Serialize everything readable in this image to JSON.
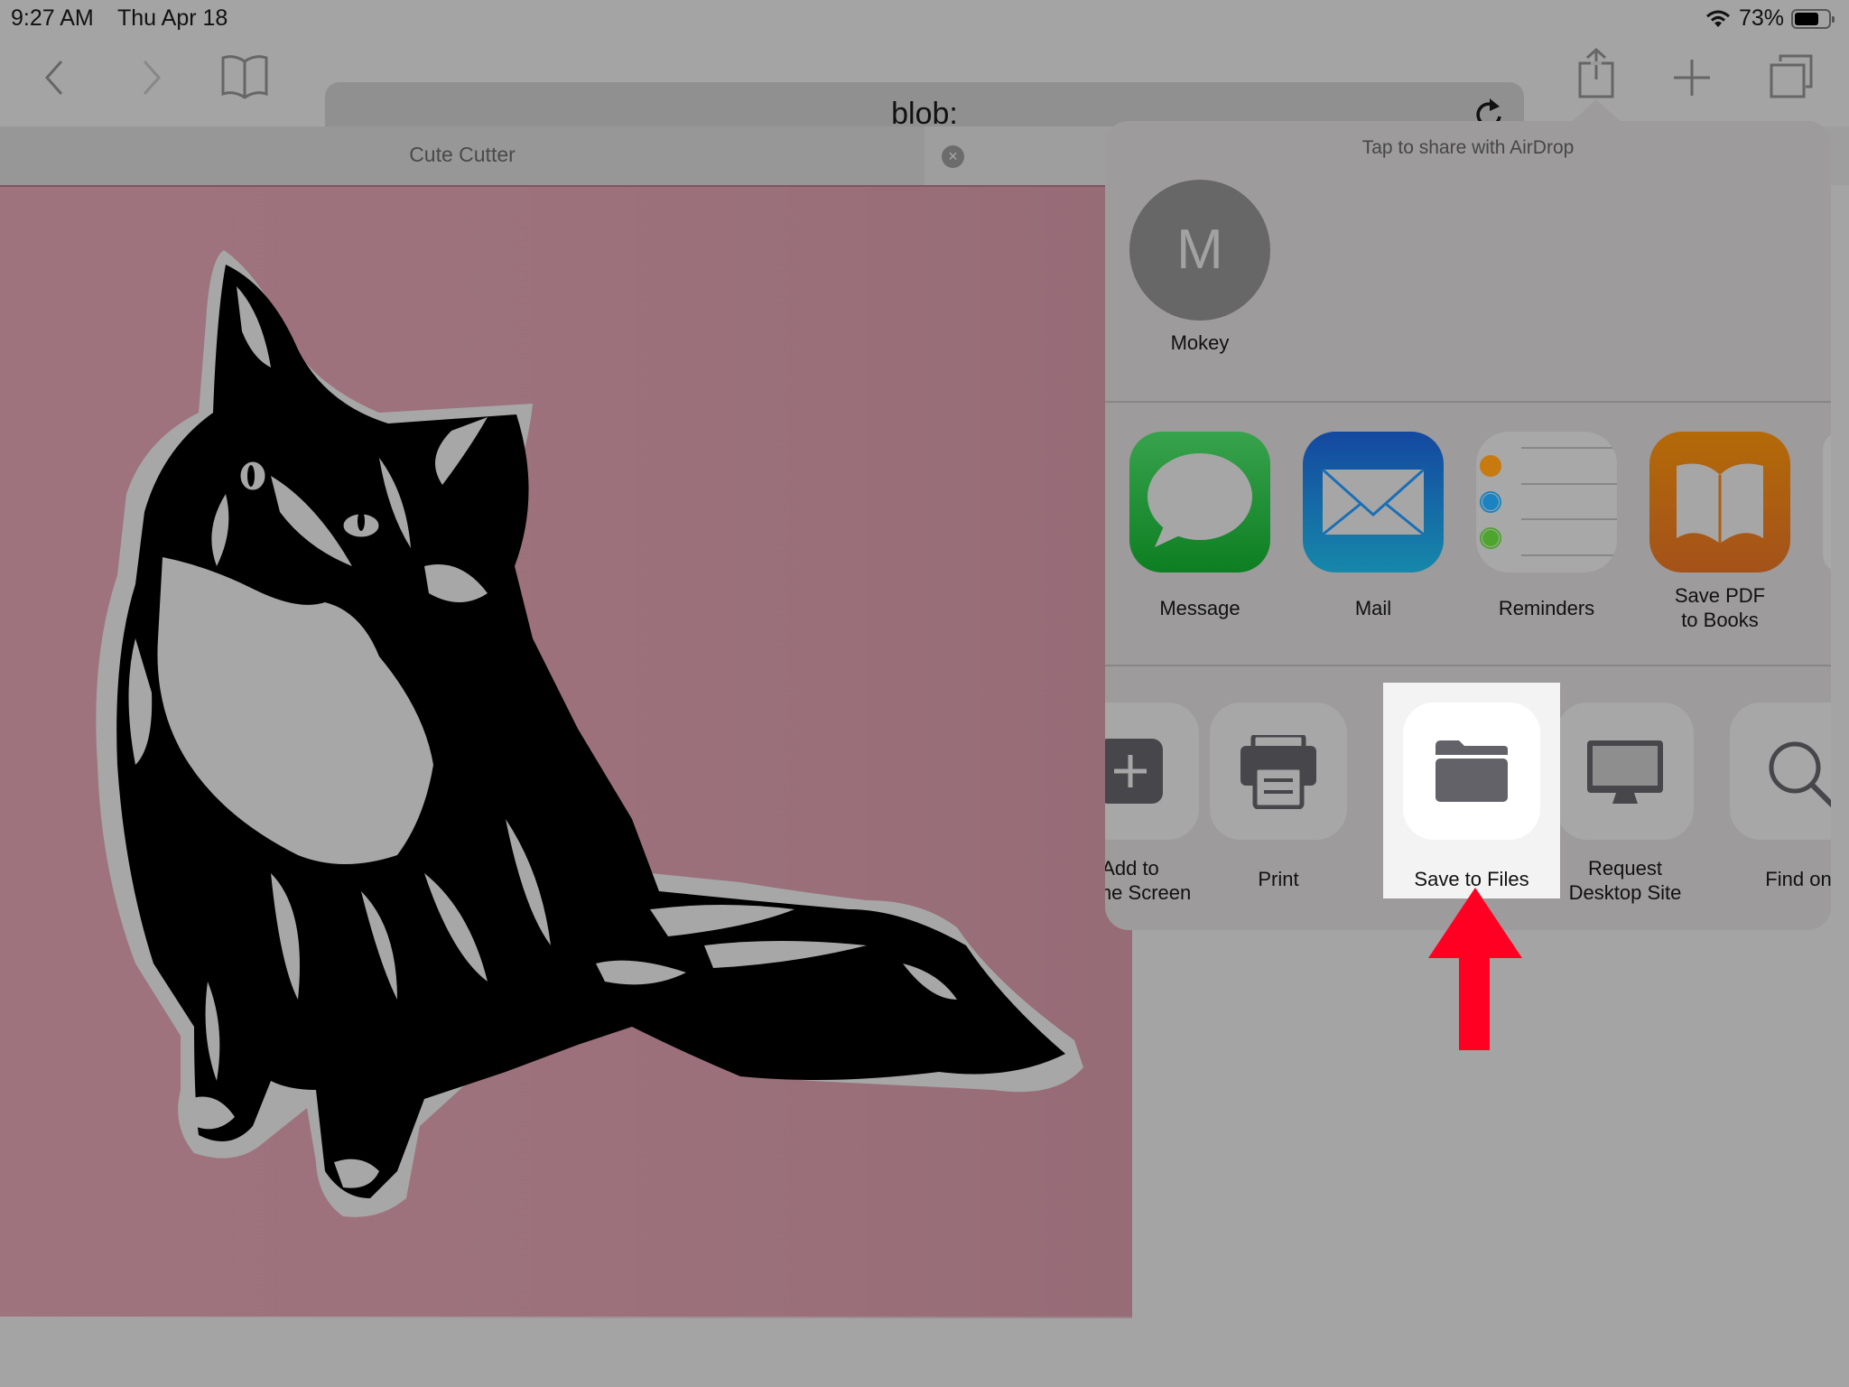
{
  "status_bar": {
    "time": "9:27 AM",
    "date": "Thu Apr 18",
    "battery_percent": "73%",
    "battery_level": 0.73,
    "icons": [
      "wifi-icon",
      "battery-icon"
    ]
  },
  "toolbar": {
    "back_icon": "chevron-left-icon",
    "forward_icon": "chevron-right-icon",
    "bookmarks_icon": "book-icon",
    "url": "blob:",
    "reload_icon": "reload-icon",
    "share_icon": "share-icon",
    "new_tab_icon": "plus-icon",
    "tabs_icon": "tabs-icon"
  },
  "tabs": [
    {
      "title": "Cute Cutter",
      "active": true,
      "close_icon": "close-circle-icon"
    }
  ],
  "content": {
    "description": "cat illustration",
    "background_color": "#9e737d"
  },
  "share_sheet": {
    "airdrop": {
      "title": "Tap to share with AirDrop",
      "contacts": [
        {
          "initial": "M",
          "name": "Mokey"
        }
      ]
    },
    "apps": [
      {
        "label": "Message",
        "icon": "messages-icon",
        "color": "#1a9a32"
      },
      {
        "label": "Mail",
        "icon": "mail-icon",
        "color": "#1b6cc0"
      },
      {
        "label": "Reminders",
        "icon": "reminders-icon",
        "color": "#a8a8a8"
      },
      {
        "label": "Save PDF\nto Books",
        "label_line1": "Save PDF",
        "label_line2": "to Books",
        "icon": "books-icon",
        "color": "#b3620d"
      }
    ],
    "actions": [
      {
        "label_line1": "Add to",
        "label_line2": "Home Screen",
        "icon": "add-square-icon"
      },
      {
        "label": "Print",
        "icon": "printer-icon"
      },
      {
        "label": "Save to Files",
        "icon": "folder-icon",
        "highlighted": true
      },
      {
        "label_line1": "Request",
        "label_line2": "Desktop Site",
        "icon": "desktop-icon"
      },
      {
        "label": "Find on Page",
        "label_visible": "Find on",
        "icon": "search-icon"
      }
    ]
  },
  "annotation": {
    "arrow_color": "#ff0022",
    "points_to": "Save to Files"
  }
}
